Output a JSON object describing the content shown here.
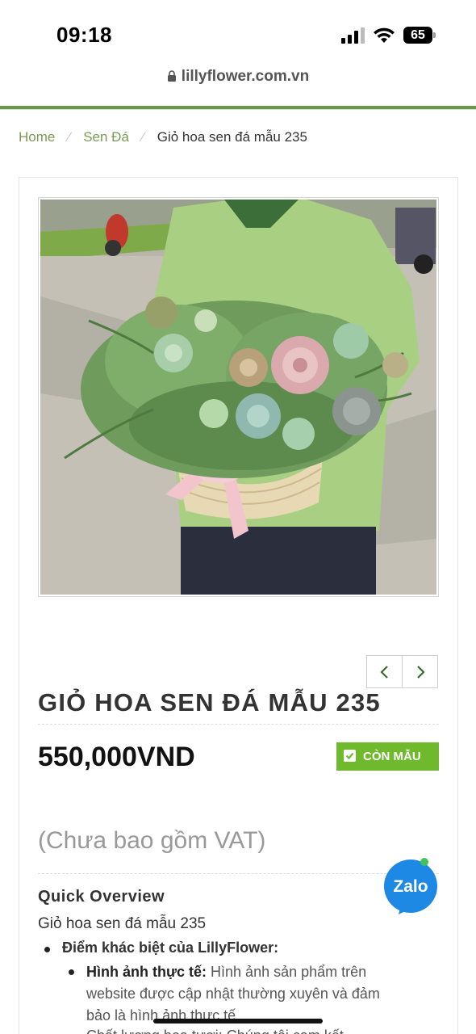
{
  "status_bar": {
    "time": "09:18",
    "battery": "65"
  },
  "browser": {
    "url": "lillyflower.com.vn"
  },
  "breadcrumb": {
    "home": "Home",
    "category": "Sen Đá",
    "current": "Giỏ hoa sen đá mẫu 235"
  },
  "product": {
    "title": "GIỎ HOA SEN ĐÁ MẪU 235",
    "price": "550,000VND",
    "stock_label": "CÒN MẪU",
    "vat_note": "(Chưa bao gồm VAT)"
  },
  "overview": {
    "heading": "Quick Overview",
    "name": "Giỏ hoa sen đá mẫu 235",
    "difference_label": "Điểm khác biệt của LillyFlower:",
    "real_image_label": "Hình ảnh thực tế:",
    "real_image_text": " Hình ảnh sản phẩm trên website được cập nhật thường xuyên và đảm bảo là hình ảnh thực tế",
    "next_item_partial": "Chất lượng hoa tươi: Chúng tôi cam kết"
  },
  "chat_widget": {
    "label": "Zalo"
  },
  "colors": {
    "accent_green": "#6a9a47",
    "breadcrumb_link": "#7a9a55",
    "stock_badge": "#6fba2c",
    "zalo_blue": "#1e88e5"
  },
  "icons": [
    "lock-icon",
    "signal-icon",
    "wifi-icon",
    "battery-icon",
    "chevron-left-icon",
    "chevron-right-icon",
    "checkbox-icon",
    "zalo-icon"
  ]
}
